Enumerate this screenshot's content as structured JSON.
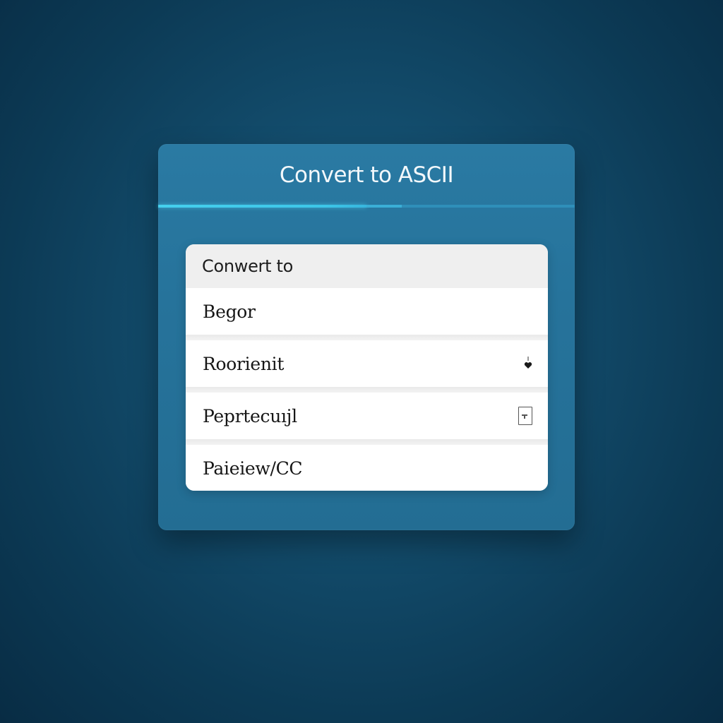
{
  "dialog": {
    "title": "Convert to ASCII",
    "progress": 0.5
  },
  "card": {
    "header_label": "Conwert to",
    "options": [
      {
        "label": "Begor",
        "icon": ""
      },
      {
        "label": "Roorienit",
        "icon": "heart-icon"
      },
      {
        "label": "Peprtecuıjl",
        "icon": "panel-icon"
      },
      {
        "label": "Paieiew/CC",
        "icon": ""
      }
    ]
  },
  "colors": {
    "background": "#0f4666",
    "dialog": "#26739b",
    "accent": "#45d0ee",
    "card": "#ffffff",
    "card_header": "#efefef"
  }
}
